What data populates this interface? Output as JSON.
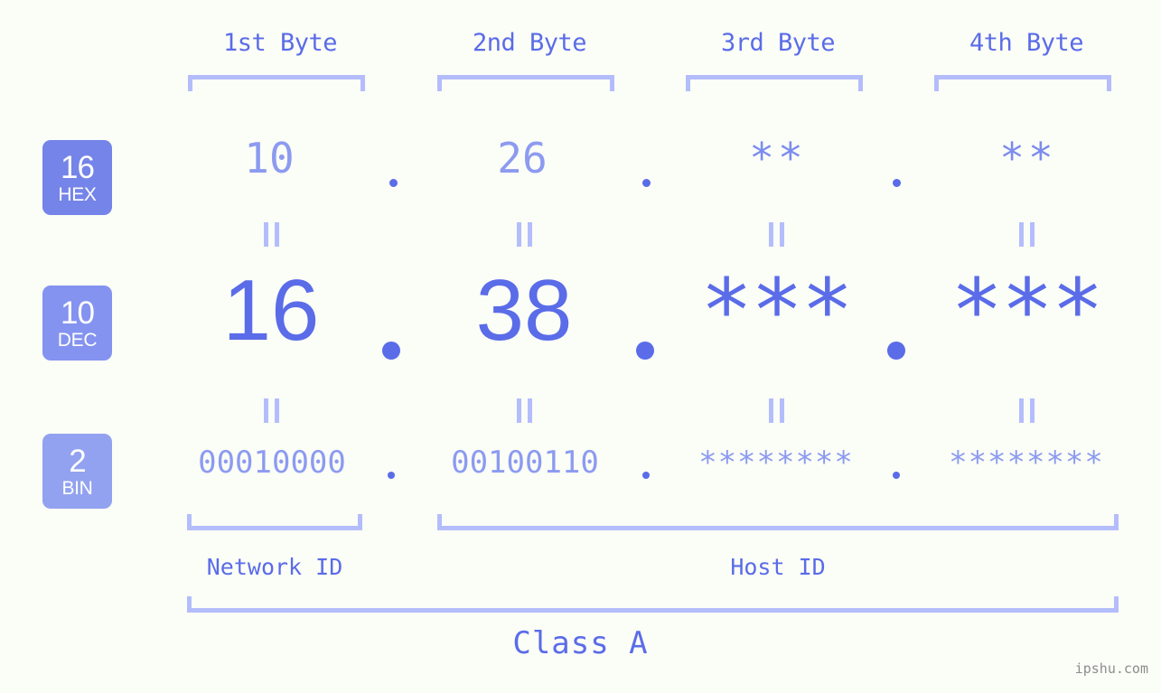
{
  "page": {
    "background_color": "#fbfdf7",
    "accent_color": "#5a6ce8",
    "accent_light_color": "#8c9bf0",
    "bracket_color": "#b4bdfb",
    "watermark": "ipshu.com"
  },
  "columns": [
    {
      "header": "1st Byte"
    },
    {
      "header": "2nd Byte"
    },
    {
      "header": "3rd Byte"
    },
    {
      "header": "4th Byte"
    }
  ],
  "bases": [
    {
      "number": "16",
      "label": "HEX",
      "color": "#7584e8"
    },
    {
      "number": "10",
      "label": "DEC",
      "color": "#8493ef"
    },
    {
      "number": "2",
      "label": "BIN",
      "color": "#92a2f0"
    }
  ],
  "rows": {
    "hex": {
      "base_number": "16",
      "base_label": "HEX",
      "values": [
        "10",
        "26",
        "**",
        "**"
      ],
      "masked": [
        false,
        false,
        true,
        true
      ]
    },
    "dec": {
      "base_number": "10",
      "base_label": "DEC",
      "values": [
        "16",
        "38",
        "***",
        "***"
      ],
      "masked": [
        false,
        false,
        true,
        true
      ]
    },
    "bin": {
      "base_number": "2",
      "base_label": "BIN",
      "values": [
        "00010000",
        "00100110",
        "********",
        "********"
      ],
      "masked": [
        false,
        false,
        true,
        true
      ]
    }
  },
  "separators": {
    "glyph": "."
  },
  "equals": {
    "glyph": "="
  },
  "footer": {
    "network_id_label": "Network ID",
    "host_id_label": "Host ID",
    "class_label": "Class A"
  }
}
